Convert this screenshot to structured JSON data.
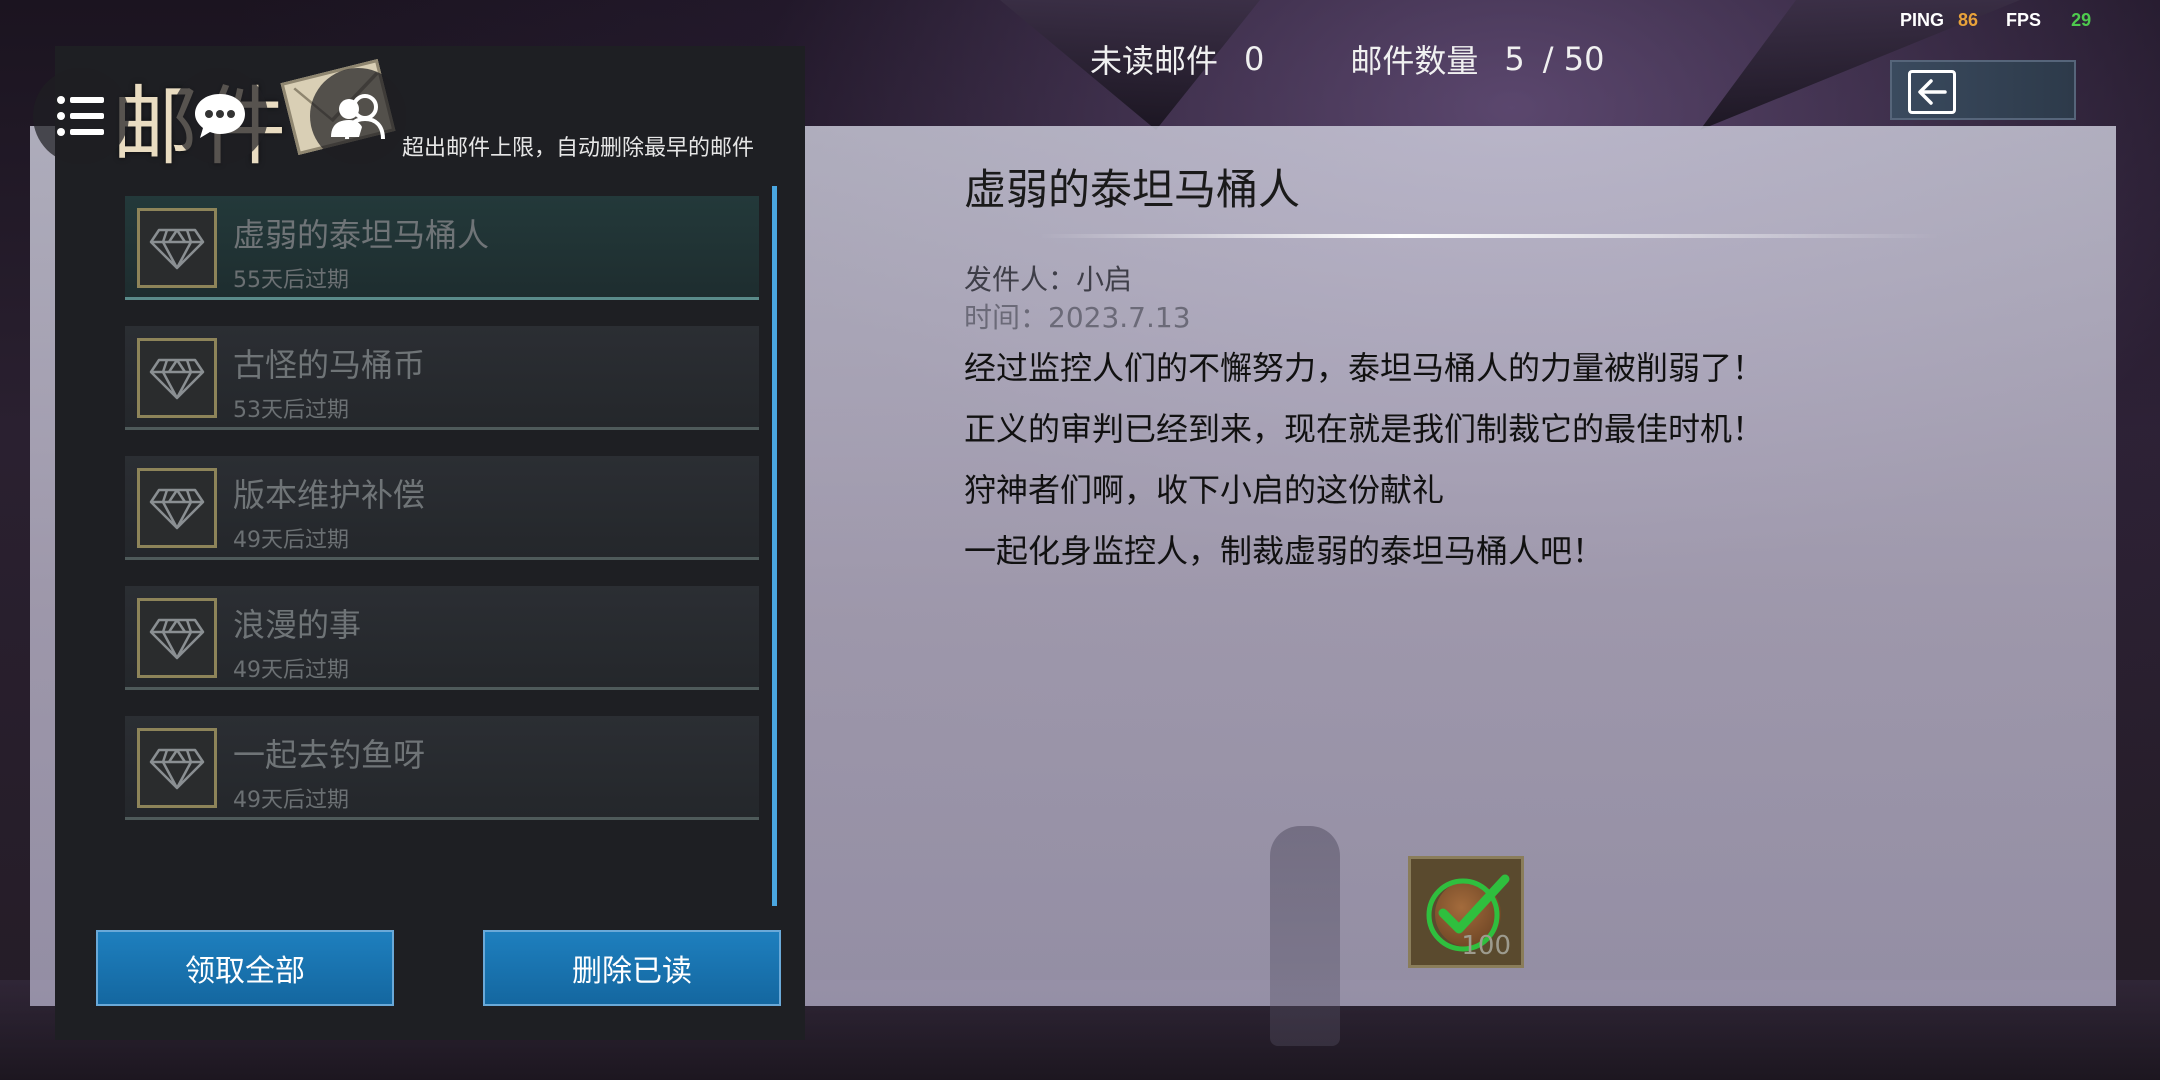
{
  "perf": {
    "ping_label": "PING",
    "ping_value": "86",
    "fps_label": "FPS",
    "fps_value": "29"
  },
  "header": {
    "unread_label": "未读邮件",
    "unread_value": "0",
    "count_label": "邮件数量",
    "count_value": "5",
    "count_max": "/ 50"
  },
  "mailbox": {
    "title": "邮件",
    "limit_note": "超出邮件上限，自动删除最早的邮件",
    "items": [
      {
        "title": "虚弱的泰坦马桶人",
        "expiry": "55天后过期"
      },
      {
        "title": "古怪的马桶币",
        "expiry": "53天后过期"
      },
      {
        "title": "版本维护补偿",
        "expiry": "49天后过期"
      },
      {
        "title": "浪漫的事",
        "expiry": "49天后过期"
      },
      {
        "title": "一起去钓鱼呀",
        "expiry": "49天后过期"
      }
    ],
    "collect_all_label": "领取全部",
    "delete_read_label": "删除已读"
  },
  "detail": {
    "title": "虚弱的泰坦马桶人",
    "sender": "发件人：小启",
    "time": "时间：2023.7.13",
    "lines": [
      "经过监控人们的不懈努力，泰坦马桶人的力量被削弱了！",
      "正义的审判已经到来，现在就是我们制裁它的最佳时机！",
      "狩神者们啊，收下小启的这份献礼",
      "一起化身监控人，制裁虚弱的泰坦马桶人吧！"
    ],
    "reward": {
      "quantity": "100",
      "claimed": true
    }
  },
  "icons": {
    "menu": "menu-icon",
    "chat": "chat-icon",
    "people": "people-icon",
    "back": "back-arrow-icon",
    "gem": "diamond-icon",
    "check": "checkmark-icon"
  },
  "colors": {
    "accent_blue": "#1e7fbe",
    "ping": "#e8a23a",
    "fps": "#4ec94e",
    "check_green": "#2fbf3e"
  }
}
